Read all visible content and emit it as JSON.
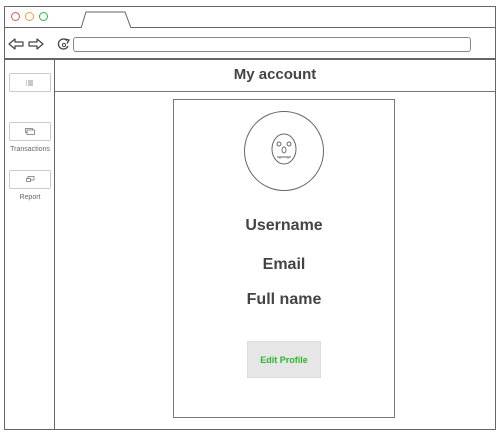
{
  "window": {
    "controls": [
      "close",
      "minimize",
      "maximize"
    ],
    "colors": {
      "close": "#e05a4e",
      "minimize": "#e0a23a",
      "maximize": "#2fb44a"
    }
  },
  "navbar": {
    "icons": [
      "back-arrow-icon",
      "forward-arrow-icon",
      "reload-icon"
    ],
    "url_value": ""
  },
  "sidebar": {
    "items": [
      {
        "label": "",
        "icon": "list-icon"
      },
      {
        "label": "Transactions",
        "icon": "money-icon"
      },
      {
        "label": "Report",
        "icon": "chat-icon"
      }
    ]
  },
  "header": {
    "title": "My account"
  },
  "profile": {
    "avatar_icon": "face-icon",
    "username_label": "Username",
    "email_label": "Email",
    "fullname_label": "Full name",
    "edit_button_label": "Edit Profile",
    "accent_color": "#2bb52b"
  }
}
